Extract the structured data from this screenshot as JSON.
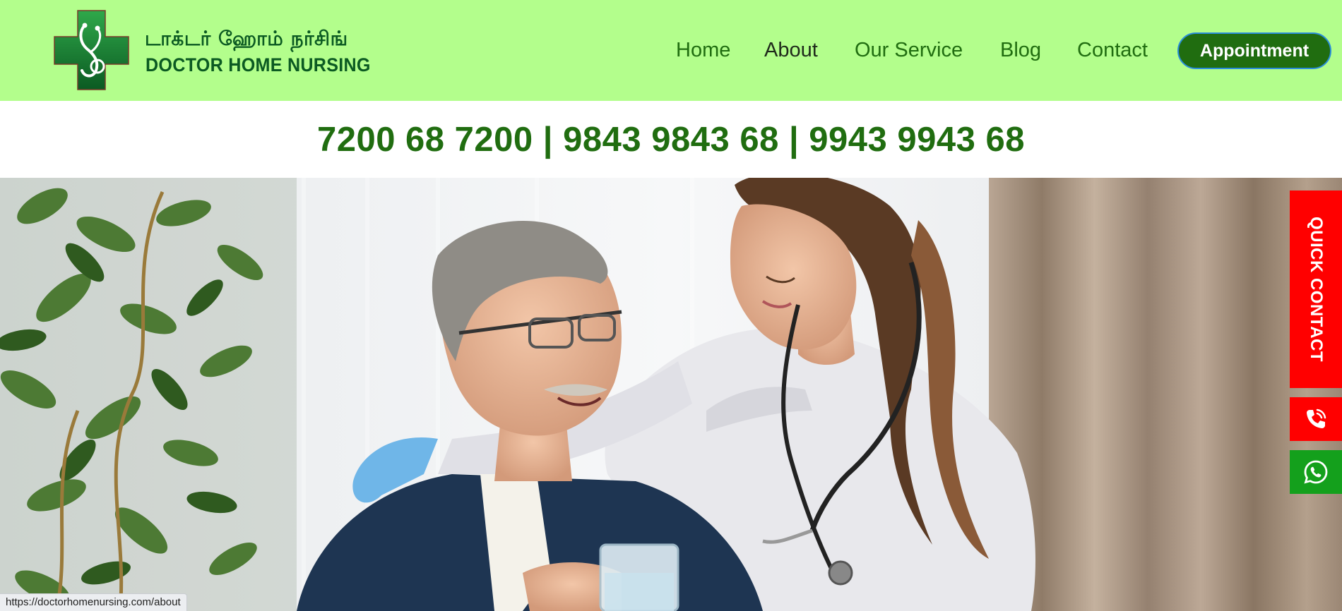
{
  "header": {
    "brand_tamil": "டாக்டர் ஹோம் நர்சிங்",
    "brand_english": "DOCTOR HOME NURSING",
    "logo_icon": "green-cross-stethoscope-logo"
  },
  "nav": {
    "items": [
      {
        "label": "Home",
        "active": false
      },
      {
        "label": "About",
        "active": true
      },
      {
        "label": "Our Service",
        "active": false
      },
      {
        "label": "Blog",
        "active": false
      },
      {
        "label": "Contact",
        "active": false
      }
    ],
    "appointment_label": "Appointment"
  },
  "phones": {
    "text": "7200 68 7200 | 9843 9843 68 | 9943 9943 68"
  },
  "hero": {
    "image": "photo of smiling nurse with stethoscope and blue gloves caring for seated elderly man with glasses holding a glass of water"
  },
  "floating": {
    "quick_contact_label": "QUICK CONTACT",
    "call_icon": "phone-call-icon",
    "whatsapp_icon": "whatsapp-icon"
  },
  "status_bar": {
    "url": "https://doctorhomenursing.com/about"
  },
  "colors": {
    "header_bg": "#b3fe8c",
    "brand_green": "#206d10",
    "logo_green": "#0b5a22",
    "quick_contact_red": "#ff0000",
    "whatsapp_green": "#14a01c"
  }
}
